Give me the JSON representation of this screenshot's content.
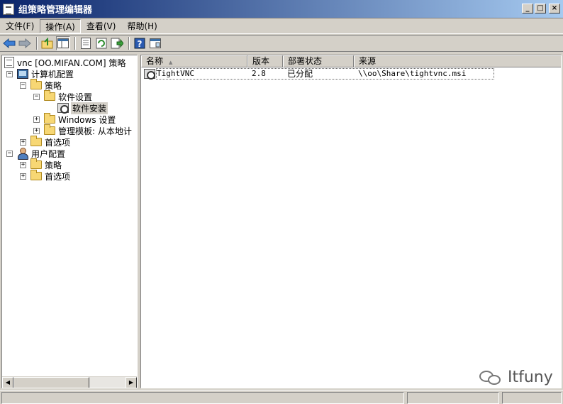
{
  "window": {
    "title": "组策略管理编辑器",
    "buttons": [
      "_",
      "□",
      "×"
    ]
  },
  "menu": [
    {
      "label": "文件(F)"
    },
    {
      "label": "操作(A)"
    },
    {
      "label": "查看(V)"
    },
    {
      "label": "帮助(H)"
    }
  ],
  "toolbar": {
    "items": [
      "back-icon",
      "forward-icon",
      "up-folder-icon",
      "show-tree-icon",
      "properties-icon",
      "refresh-icon",
      "export-icon",
      "help-icon",
      "console-view-icon"
    ]
  },
  "tree": {
    "root": "vnc [OO.MIFAN.COM] 策略",
    "computer_config": "计算机配置",
    "policies": "策略",
    "software_settings": "软件设置",
    "software_install": "软件安装",
    "windows_settings": "Windows 设置",
    "admin_templates": "管理模板: 从本地计",
    "preferences": "首选项",
    "user_config": "用户配置",
    "user_policies": "策略",
    "user_preferences": "首选项"
  },
  "list": {
    "columns": [
      "名称",
      "版本",
      "部署状态",
      "来源"
    ],
    "rows": [
      {
        "name": "TightVNC",
        "version": "2.8",
        "state": "已分配",
        "source": "\\\\oo\\Share\\tightvnc.msi"
      }
    ]
  },
  "watermark": "Itfuny"
}
